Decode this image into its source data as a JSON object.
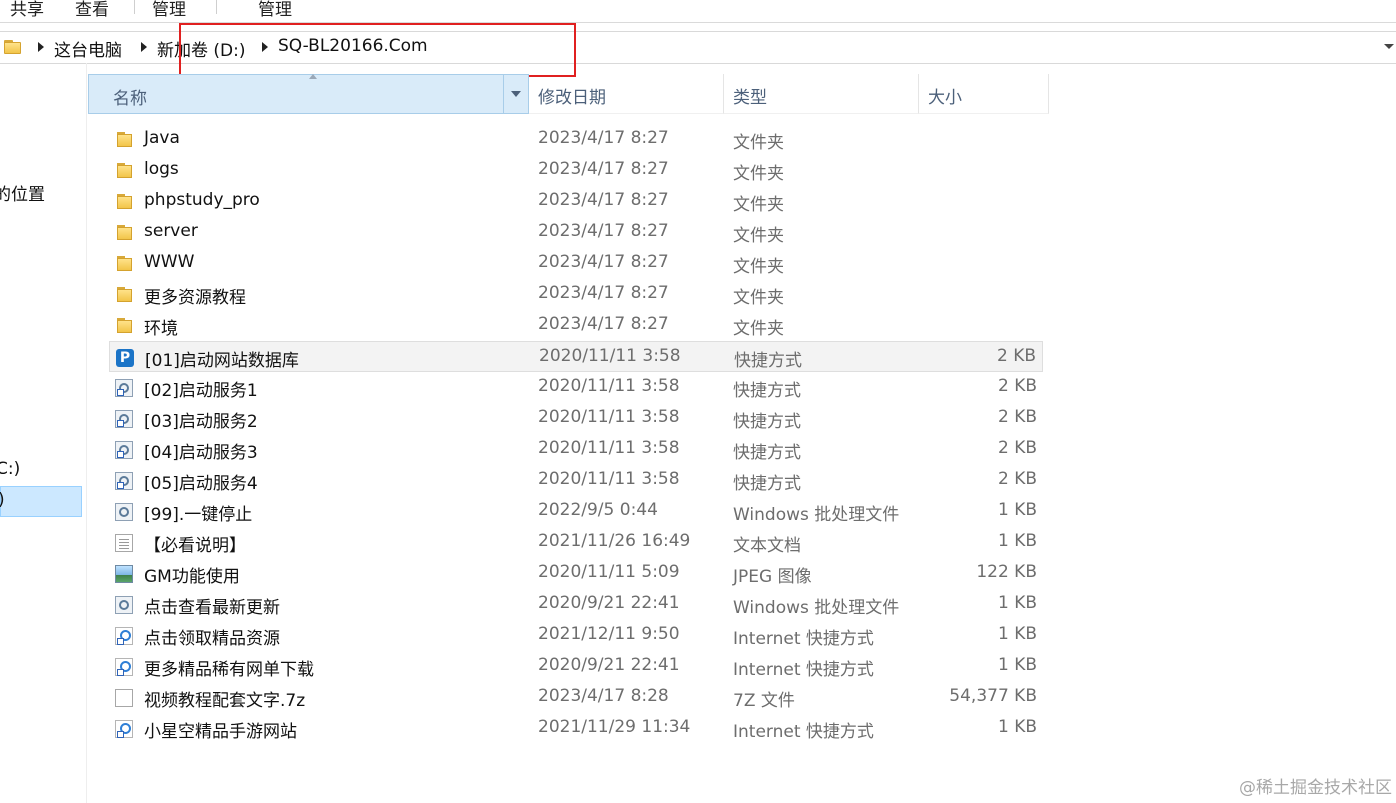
{
  "ribbon": {
    "tabs": [
      "共享",
      "查看",
      "管理",
      "管理"
    ]
  },
  "address": {
    "crumbs": [
      "这台电脑",
      "新加卷 (D:)",
      "SQ-BL20166.Com"
    ]
  },
  "nav": {
    "items": [
      "的位置",
      "C:)",
      ")"
    ]
  },
  "columns": {
    "name": "名称",
    "date": "修改日期",
    "type": "类型",
    "size": "大小"
  },
  "files": [
    {
      "name": "Java",
      "date": "2023/4/17 8:27",
      "type": "文件夹",
      "size": "",
      "icon": "folder-icon"
    },
    {
      "name": "logs",
      "date": "2023/4/17 8:27",
      "type": "文件夹",
      "size": "",
      "icon": "folder-icon"
    },
    {
      "name": "phpstudy_pro",
      "date": "2023/4/17 8:27",
      "type": "文件夹",
      "size": "",
      "icon": "folder-icon"
    },
    {
      "name": "server",
      "date": "2023/4/17 8:27",
      "type": "文件夹",
      "size": "",
      "icon": "folder-icon"
    },
    {
      "name": "WWW",
      "date": "2023/4/17 8:27",
      "type": "文件夹",
      "size": "",
      "icon": "folder-icon"
    },
    {
      "name": "更多资源教程",
      "date": "2023/4/17 8:27",
      "type": "文件夹",
      "size": "",
      "icon": "folder-icon"
    },
    {
      "name": "环境",
      "date": "2023/4/17 8:27",
      "type": "文件夹",
      "size": "",
      "icon": "folder-icon"
    },
    {
      "name": "[01]启动网站数据库",
      "date": "2020/11/11 3:58",
      "type": "快捷方式",
      "size": "2 KB",
      "icon": "phpstudy-shortcut-icon"
    },
    {
      "name": "[02]启动服务1",
      "date": "2020/11/11 3:58",
      "type": "快捷方式",
      "size": "2 KB",
      "icon": "batch-shortcut-icon"
    },
    {
      "name": "[03]启动服务2",
      "date": "2020/11/11 3:58",
      "type": "快捷方式",
      "size": "2 KB",
      "icon": "batch-shortcut-icon"
    },
    {
      "name": "[04]启动服务3",
      "date": "2020/11/11 3:58",
      "type": "快捷方式",
      "size": "2 KB",
      "icon": "batch-shortcut-icon"
    },
    {
      "name": "[05]启动服务4",
      "date": "2020/11/11 3:58",
      "type": "快捷方式",
      "size": "2 KB",
      "icon": "batch-shortcut-icon"
    },
    {
      "name": "[99].一键停止",
      "date": "2022/9/5 0:44",
      "type": "Windows 批处理文件",
      "size": "1 KB",
      "icon": "batch-file-icon"
    },
    {
      "name": "【必看说明】",
      "date": "2021/11/26 16:49",
      "type": "文本文档",
      "size": "1 KB",
      "icon": "text-document-icon"
    },
    {
      "name": "GM功能使用",
      "date": "2020/11/11 5:09",
      "type": "JPEG 图像",
      "size": "122 KB",
      "icon": "image-file-icon"
    },
    {
      "name": "点击查看最新更新",
      "date": "2020/9/21 22:41",
      "type": "Windows 批处理文件",
      "size": "1 KB",
      "icon": "batch-file-icon"
    },
    {
      "name": "点击领取精品资源",
      "date": "2021/12/11 9:50",
      "type": "Internet 快捷方式",
      "size": "1 KB",
      "icon": "internet-shortcut-icon"
    },
    {
      "name": "更多精品稀有网单下载",
      "date": "2020/9/21 22:41",
      "type": "Internet 快捷方式",
      "size": "1 KB",
      "icon": "internet-shortcut-icon"
    },
    {
      "name": "视频教程配套文字.7z",
      "date": "2023/4/17 8:28",
      "type": "7Z 文件",
      "size": "54,377 KB",
      "icon": "archive-file-icon"
    },
    {
      "name": "小星空精品手游网站",
      "date": "2021/11/29 11:34",
      "type": "Internet 快捷方式",
      "size": "1 KB",
      "icon": "internet-shortcut-icon"
    }
  ],
  "hovered_row": 7,
  "watermark": "@稀土掘金技术社区"
}
